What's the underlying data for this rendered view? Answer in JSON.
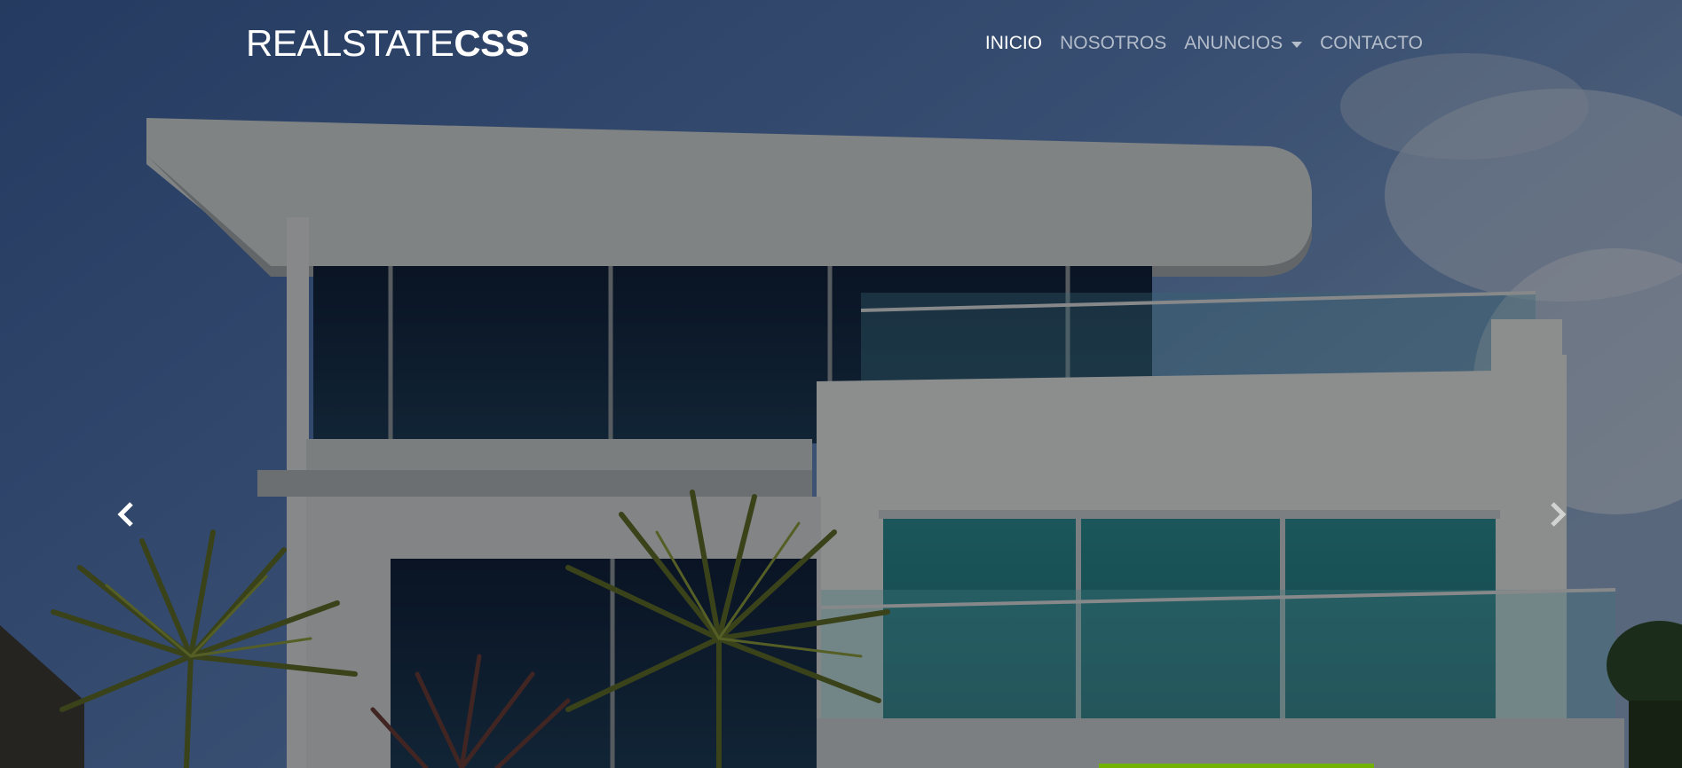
{
  "brand": {
    "light": "REALSTATE",
    "bold": "CSS"
  },
  "nav": {
    "items": [
      {
        "label": "INICIO",
        "active": true
      },
      {
        "label": "NOSOTROS",
        "active": false
      },
      {
        "label": "ANUNCIOS",
        "active": false,
        "dropdown": true
      },
      {
        "label": "CONTACTO",
        "active": false
      }
    ]
  },
  "carousel": {
    "prev_icon": "chevron-left-icon",
    "next_icon": "chevron-right-icon",
    "active_indicator_color": "#71b100"
  },
  "colors": {
    "nav_active": "#ffffff",
    "nav_inactive": "rgba(255,255,255,0.62)",
    "accent": "#71b100"
  }
}
